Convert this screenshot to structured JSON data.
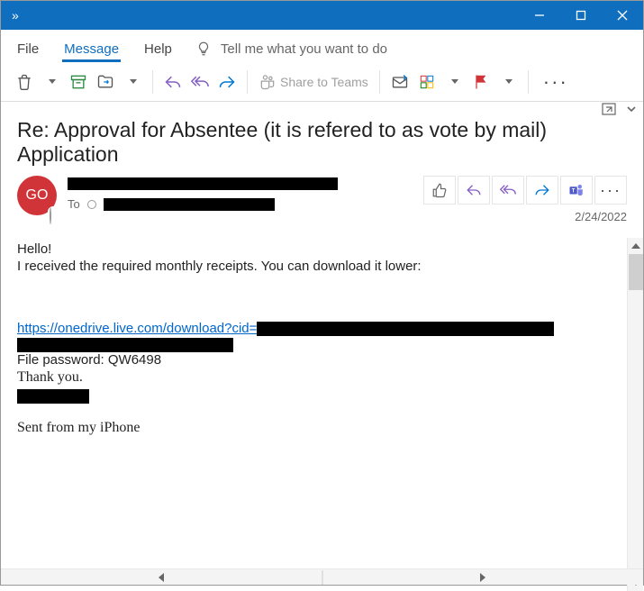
{
  "titlebar": {
    "caption": "»"
  },
  "tabs": {
    "file": "File",
    "message": "Message",
    "help": "Help"
  },
  "tellme": {
    "placeholder": "Tell me what you want to do"
  },
  "toolbar": {
    "share_teams": "Share to Teams"
  },
  "subject": "Re: Approval for Absentee (it is refered to as vote by mail) Application",
  "avatar": {
    "initials": "GO"
  },
  "to_label": "To",
  "date": "2/24/2022",
  "body": {
    "greet": "Hello!",
    "line1": "I received the required monthly receipts. You can download it lower:",
    "link_visible": "https://onedrive.live.com/download?cid=",
    "file_pw": "File password: QW6498",
    "thank": "Thank you.",
    "sent_from": "Sent from my iPhone"
  }
}
